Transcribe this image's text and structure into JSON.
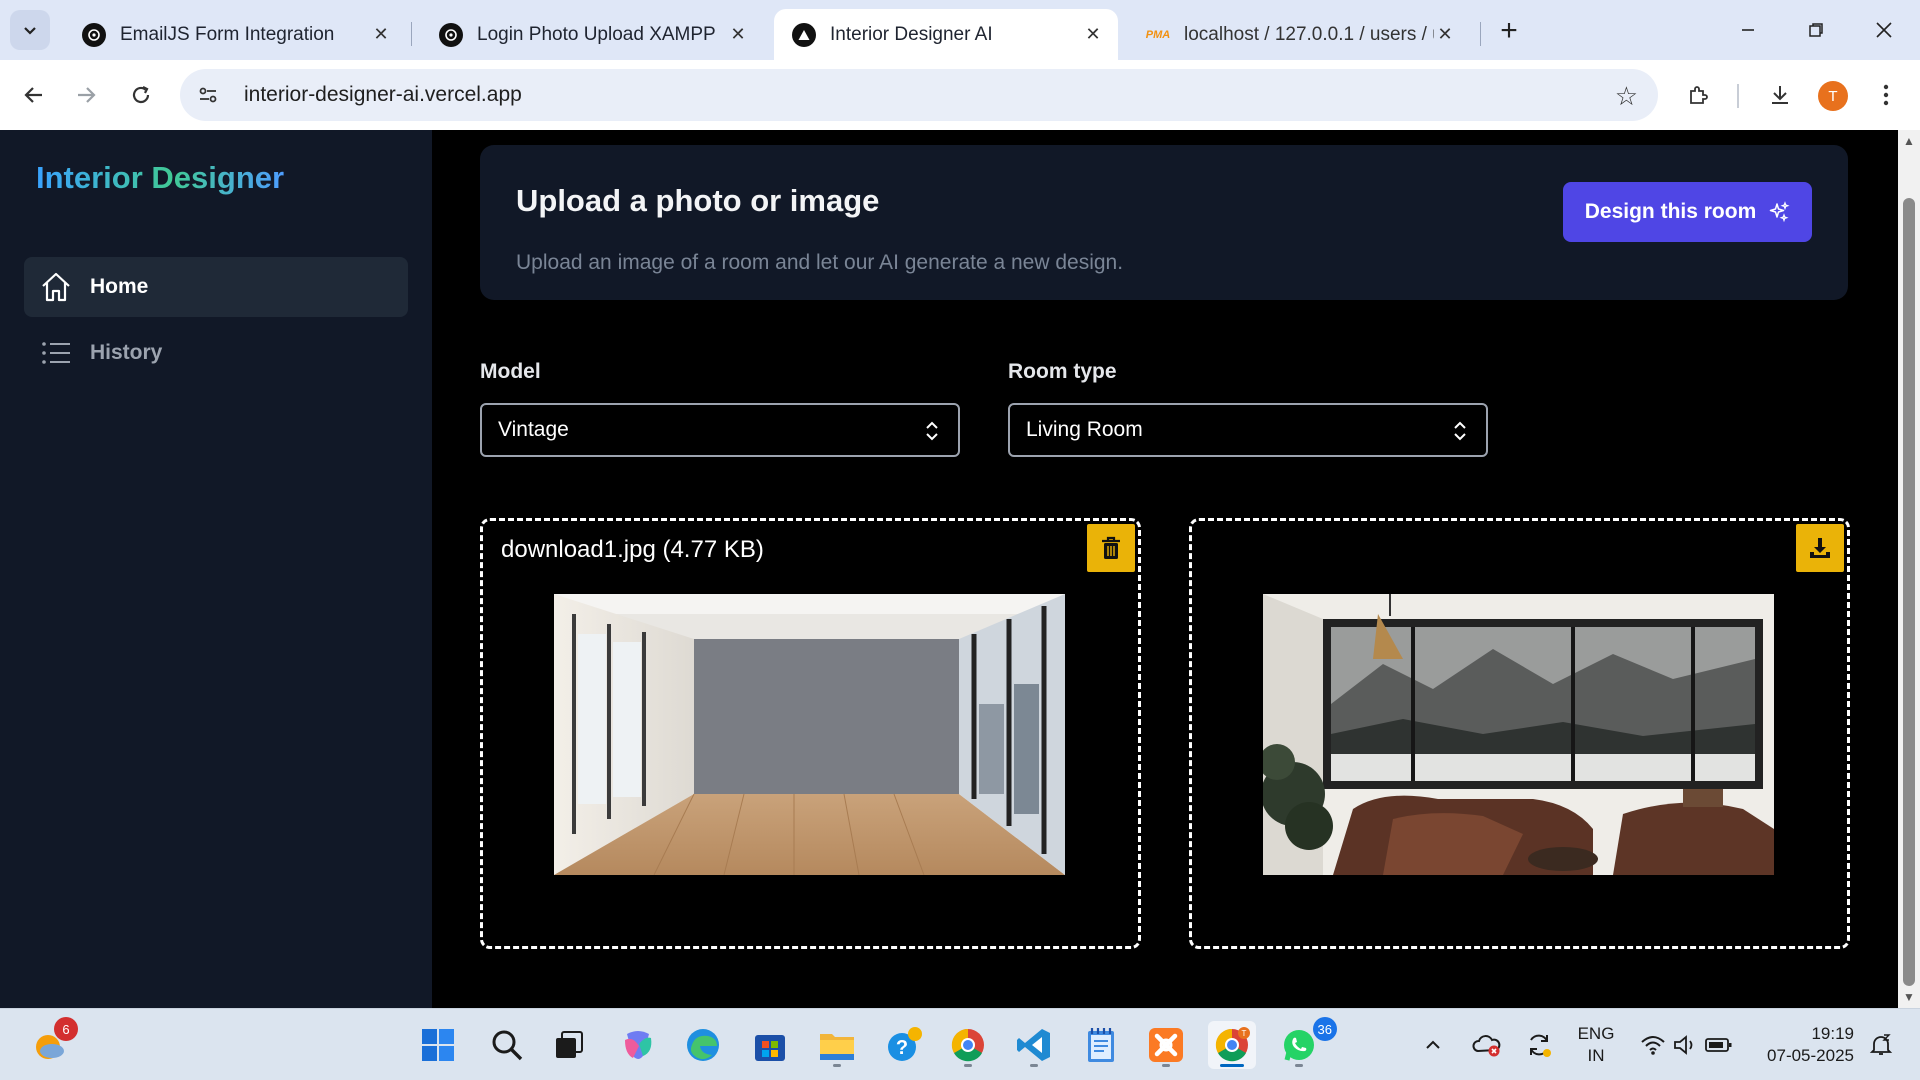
{
  "browser": {
    "tabs": [
      {
        "title": "EmailJS Form Integration",
        "active": false
      },
      {
        "title": "Login Photo Upload XAMPP",
        "active": false
      },
      {
        "title": "Interior Designer AI",
        "active": true
      },
      {
        "title": "localhost / 127.0.0.1 / users / us",
        "active": false
      }
    ],
    "url": "interior-designer-ai.vercel.app",
    "profile_initial": "T",
    "pma_favicon_text": "PMA"
  },
  "sidebar": {
    "brand": "Interior Designer",
    "items": [
      {
        "label": "Home",
        "icon": "home-icon",
        "active": true
      },
      {
        "label": "History",
        "icon": "list-icon",
        "active": false
      }
    ]
  },
  "hero": {
    "title": "Upload a photo or image",
    "subtitle": "Upload an image of a room and let our AI generate a new design.",
    "button_label": "Design this room"
  },
  "form": {
    "model_label": "Model",
    "model_value": "Vintage",
    "room_label": "Room type",
    "room_value": "Living Room"
  },
  "panels": {
    "input_file": "download1.jpg (4.77 KB)"
  },
  "taskbar": {
    "weather_badge": "6",
    "whatsapp_badge": "36",
    "chrome_profile_initial": "T",
    "lang_line1": "ENG",
    "lang_line2": "IN",
    "time": "19:19",
    "date": "07-05-2025"
  },
  "colors": {
    "accent": "#4f46e5",
    "sidebar_bg": "#111827",
    "action_yellow": "#eab308"
  }
}
